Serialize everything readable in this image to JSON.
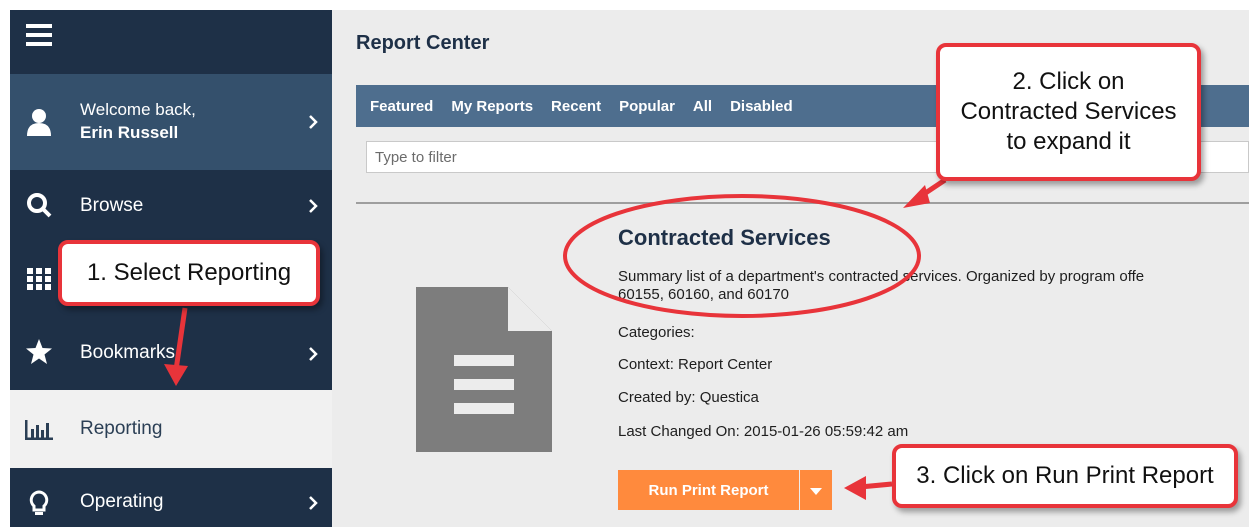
{
  "sidebar": {
    "welcome_line1": "Welcome back,",
    "welcome_line2": "Erin Russell",
    "items": [
      {
        "label": "Browse",
        "icon": "search-icon"
      },
      {
        "label": "Bookmarks",
        "icon": "star-icon"
      },
      {
        "label": "Reporting",
        "icon": "bar-chart-icon"
      },
      {
        "label": "Operating",
        "icon": "lightbulb-icon"
      }
    ]
  },
  "main": {
    "title": "Report Center",
    "tabs": [
      "Featured",
      "My Reports",
      "Recent",
      "Popular",
      "All",
      "Disabled"
    ],
    "filter_placeholder": "Type to filter",
    "report": {
      "title": "Contracted Services",
      "description_line1": "Summary list of a department's contracted services. Organized by program offe",
      "description_line2": "60155, 60160, and 60170",
      "categories": "Categories:",
      "context": "Context: Report Center",
      "created_by": "Created by: Questica",
      "last_changed": "Last Changed On: 2015-01-26 05:59:42 am",
      "run_button": "Run Print Report"
    }
  },
  "annotations": {
    "step1": "1. Select Reporting",
    "step2_line1": "2. Click on",
    "step2_line2": "Contracted Services",
    "step2_line3": "to expand it",
    "step3": "3. Click on Run Print Report"
  },
  "colors": {
    "sidebar_bg": "#1e3047",
    "sidebar_active_bg": "#34506c",
    "tabs_bg": "#4e6e8e",
    "accent_orange": "#ff8a3d",
    "annotation_red": "#e8343a"
  }
}
